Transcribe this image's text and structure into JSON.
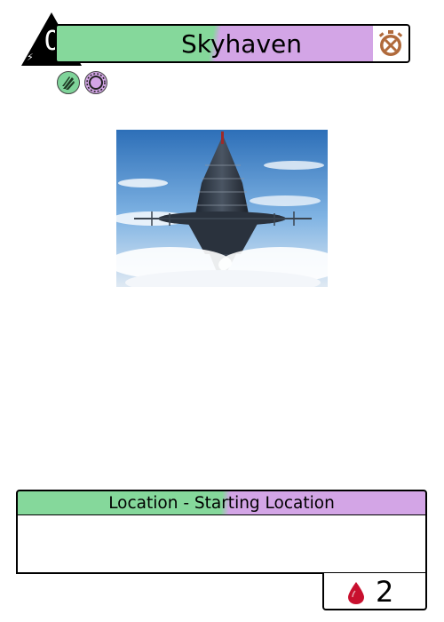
{
  "card": {
    "name": "Skyhaven",
    "cost": "0",
    "type_line": "Location - Starting Location",
    "rules_text": "",
    "stat_value": "2"
  },
  "icons": {
    "cost": "lightning-bolt-icon",
    "title": "clock-crossed-icon",
    "factions": [
      "green-claw-faction-icon",
      "purple-circle-faction-icon"
    ],
    "stat": "blood-drop-icon"
  },
  "colors": {
    "green": "#85d89b",
    "purple": "#d3a5e6",
    "title_icon": "#b06a3b",
    "blood": "#c8102e"
  }
}
